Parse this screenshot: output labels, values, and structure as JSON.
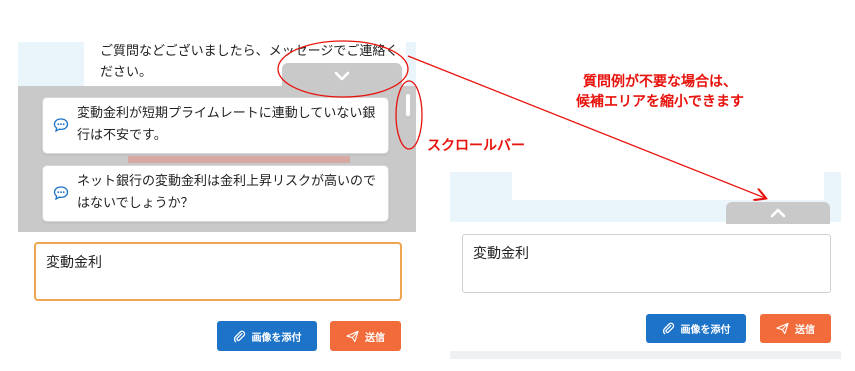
{
  "left_panel": {
    "bot_message": "ご質問などございましたら、メッセージでご連絡ください。",
    "suggestions": [
      {
        "text": "変動金利が短期プライムレートに連動していない銀行は不安です。",
        "icon": "chat-bubble-icon"
      },
      {
        "text": "ネット銀行の変動金利は金利上昇リスクが高いのではないでしょうか？",
        "icon": "chat-bubble-icon"
      }
    ],
    "collapse_icon": "chevron-down-icon",
    "input_value": "変動金利",
    "attach_label": "画像を添付",
    "send_label": "送信"
  },
  "right_panel": {
    "expand_icon": "chevron-up-icon",
    "input_value": "変動金利",
    "attach_label": "画像を添付",
    "send_label": "送信"
  },
  "annotations": {
    "main_line1": "質問例が不要な場合は、",
    "main_line2": "候補エリアを縮小できます",
    "scrollbar_label": "スクロールバー"
  },
  "colors": {
    "primary_blue": "#1d73c7",
    "send_orange": "#f26b3a",
    "focus_border": "#f0a550",
    "annotation_red": "#e8120c",
    "suggestion_bg": "#c9c9c9",
    "chat_bg": "#eaf4fb"
  }
}
